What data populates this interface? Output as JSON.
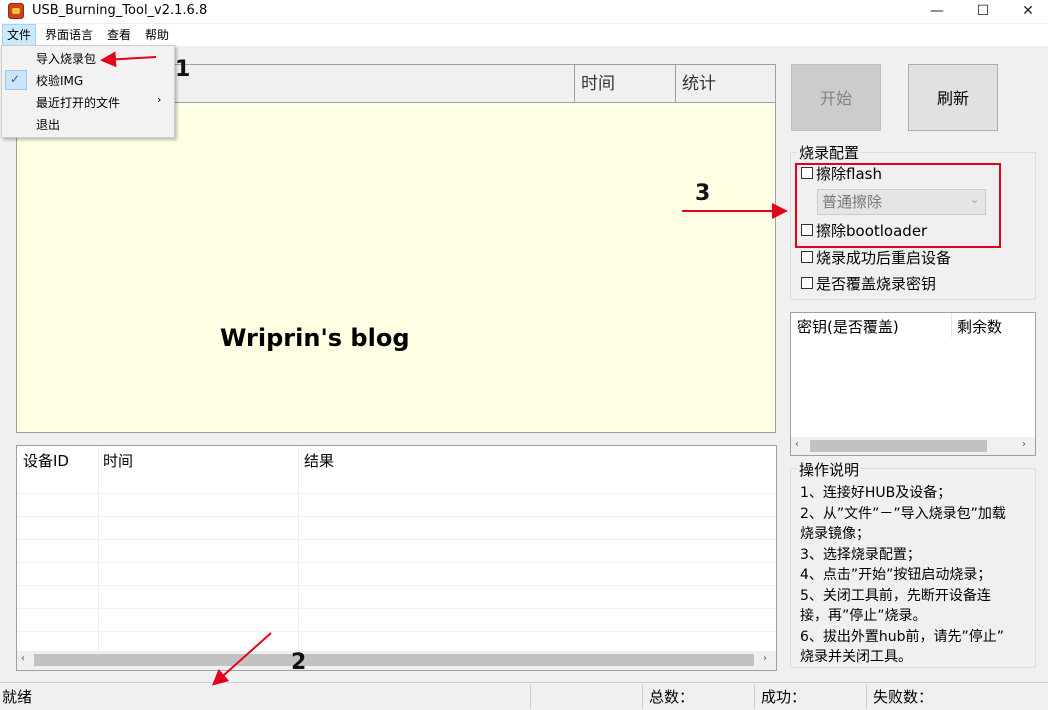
{
  "window": {
    "title": "USB_Burning_Tool_v2.1.6.8",
    "minimize_glyph": "—",
    "maximize_glyph": "☐",
    "close_glyph": "✕"
  },
  "menubar": {
    "items": [
      {
        "label": "文件"
      },
      {
        "label": "界面语言"
      },
      {
        "label": "查看"
      },
      {
        "label": "帮助"
      }
    ]
  },
  "file_menu": {
    "items": [
      {
        "label": "导入烧录包"
      },
      {
        "label": "校验IMG",
        "checked": true
      },
      {
        "label": "最近打开的文件",
        "submenu": true
      },
      {
        "label": "退出"
      }
    ],
    "check_glyph": "✓",
    "submenu_glyph": "›"
  },
  "top_list": {
    "columns": [
      "时间",
      "统计"
    ],
    "watermark": "Wriprin's blog"
  },
  "result_list": {
    "columns": [
      "设备ID",
      "时间",
      "结果"
    ],
    "scroll_left": "‹",
    "scroll_right": "›"
  },
  "buttons": {
    "start": "开始",
    "refresh": "刷新"
  },
  "burn_config": {
    "title": "烧录配置",
    "erase_flash": {
      "label": "擦除flash",
      "checked": false
    },
    "erase_mode": {
      "value": "普通擦除",
      "arrow": "⌄"
    },
    "erase_bootloader": {
      "label": "擦除bootloader",
      "checked": false
    },
    "reboot_after": {
      "label": "烧录成功后重启设备",
      "checked": false
    },
    "overwrite_key": {
      "label": "是否覆盖烧录密钥",
      "checked": false
    }
  },
  "key_list": {
    "columns": [
      "密钥(是否覆盖)",
      "剩余数"
    ]
  },
  "instructions": {
    "title": "操作说明",
    "lines": [
      "1、连接好HUB及设备；",
      "2、从”文件”－”导入烧录包”加载",
      "烧录镜像；",
      "3、选择烧录配置；",
      "4、点击”开始”按钮启动烧录；",
      "5、关闭工具前，先断开设备连",
      "接，再”停止”烧录。",
      "6、拔出外置hub前，请先”停止”",
      "烧录并关闭工具。"
    ]
  },
  "annotations": {
    "n1": "1",
    "n2": "2",
    "n3": "3",
    "arrow_color": "#e4001b"
  },
  "statusbar": {
    "status": "就绪",
    "total_label": "总数：",
    "success_label": "成功：",
    "fail_label": "失败数："
  }
}
